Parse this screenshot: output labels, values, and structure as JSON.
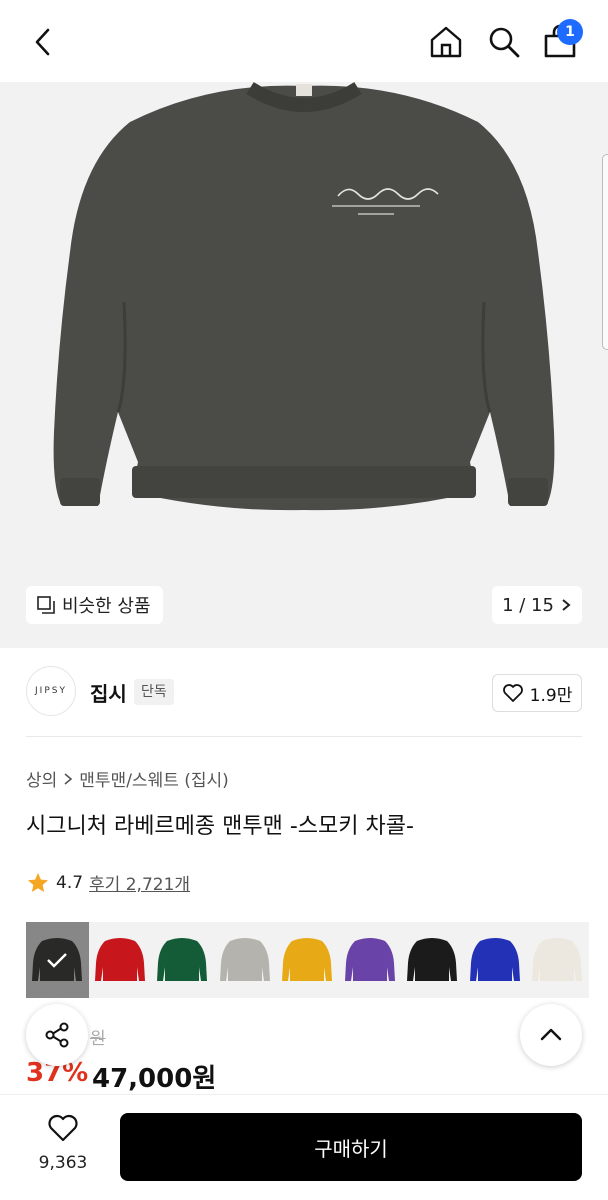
{
  "nav": {
    "cart_count": "1"
  },
  "hero": {
    "similar_label": "비슷한 상품",
    "counter": "1 / 15"
  },
  "brand": {
    "logo_text": "JIPSY",
    "name": "집시",
    "tag": "단독",
    "likes": "1.9만"
  },
  "product": {
    "breadcrumb": [
      "상의",
      "맨투맨/스웨트 (집시)"
    ],
    "title": "시그니처 라베르메종 맨투맨 -스모키 차콜-",
    "rating": "4.7",
    "review_label": "후기 2,721개",
    "original_price": "원",
    "discount": "37%",
    "price": "47,000원"
  },
  "swatches": [
    {
      "name": "charcoal",
      "color": "#3f413c",
      "selected": true
    },
    {
      "name": "red",
      "color": "#c8161d"
    },
    {
      "name": "green",
      "color": "#135c37"
    },
    {
      "name": "gray",
      "color": "#b5b3ae"
    },
    {
      "name": "yellow",
      "color": "#e8a917"
    },
    {
      "name": "purple",
      "color": "#6a43a8"
    },
    {
      "name": "black",
      "color": "#1b1b1b"
    },
    {
      "name": "blue",
      "color": "#2331b6"
    },
    {
      "name": "ivory",
      "color": "#ece8e0"
    }
  ],
  "bottom": {
    "wish_count": "9,363",
    "buy_label": "구매하기"
  },
  "icons": {
    "back": "back-icon",
    "home": "home-icon",
    "search": "search-icon",
    "bag": "bag-icon",
    "share": "share-icon",
    "up": "chevron-up-icon",
    "heart": "heart-icon",
    "star": "star-icon"
  },
  "colors": {
    "accent_blue": "#1e6cff",
    "discount_red": "#e0321e",
    "star": "#f5a623",
    "shirt": "#4b4c47"
  }
}
